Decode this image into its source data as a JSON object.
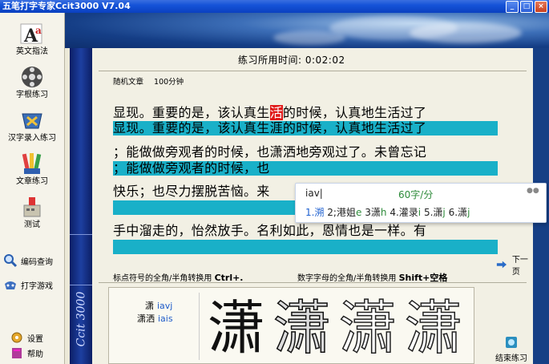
{
  "window": {
    "title": "五笔打字专家Ccit3000  V7.04",
    "buttons": [
      "_",
      "□",
      "×"
    ]
  },
  "sidebar": {
    "items": [
      {
        "label": "英文指法",
        "icon": "letter-a-icon"
      },
      {
        "label": "字根练习",
        "icon": "film-reel-icon"
      },
      {
        "label": "汉字录入练习",
        "icon": "keyboard-icon"
      },
      {
        "label": "文章练习",
        "icon": "pencils-icon"
      },
      {
        "label": "测试",
        "icon": "test-icon"
      }
    ],
    "links": [
      {
        "label": "编码查询",
        "icon": "magnifier-icon"
      },
      {
        "label": "打字游戏",
        "icon": "gamepad-icon"
      }
    ],
    "bottom": [
      {
        "label": "设置",
        "icon": "settings-icon"
      },
      {
        "label": "帮助",
        "icon": "help-book-icon"
      }
    ]
  },
  "main": {
    "timer_label": "练习所用时间: 0:02:02",
    "article_type": "随机文章",
    "speed_target": "100分钟",
    "vertical_logo": "Ccit 3000",
    "lines": [
      {
        "source_before": "显现。重要的是，该认真生",
        "source_current": "活",
        "source_after": "的时候，认真地生活过了",
        "typed": "显现。重要的是，该认真生涯的时候，认真地生活过了"
      },
      {
        "source": "；能做做旁观者的时候，也潇洒地旁观过了。未曾忘记",
        "typed": "；能做做旁观者的时候，也"
      },
      {
        "source": "快乐；也尽力摆脱苦恼。来",
        "typed": ""
      },
      {
        "source": "手中溜走的，怡然放手。名利如此，恩情也是一样。有",
        "typed": ""
      }
    ],
    "tip_left_text": "标点符号的全角/半角转换用",
    "tip_left_key": "Ctrl+.",
    "tip_right_text": "数字字母的全角/半角转换用",
    "tip_right_key": "Shift+空格",
    "next_page": "下一页",
    "end_practice": "结束练习"
  },
  "ime": {
    "input": "iav|",
    "speed": "60字/分",
    "candidates": [
      {
        "num": "1.",
        "text": "溯",
        "hint": ""
      },
      {
        "num": "2;",
        "text": "港姐",
        "hint": "e"
      },
      {
        "num": "3",
        "text": "潇",
        "hint": "h"
      },
      {
        "num": "4.",
        "text": "灌录",
        "hint": "i"
      },
      {
        "num": "5.",
        "text": "潇",
        "hint": "j"
      },
      {
        "num": "6.",
        "text": "潇",
        "hint": "j"
      }
    ]
  },
  "hint_panel": {
    "word1": "潇",
    "code1": "iavj",
    "word2": "潇洒",
    "code2": "iais",
    "glyph": "潇"
  }
}
